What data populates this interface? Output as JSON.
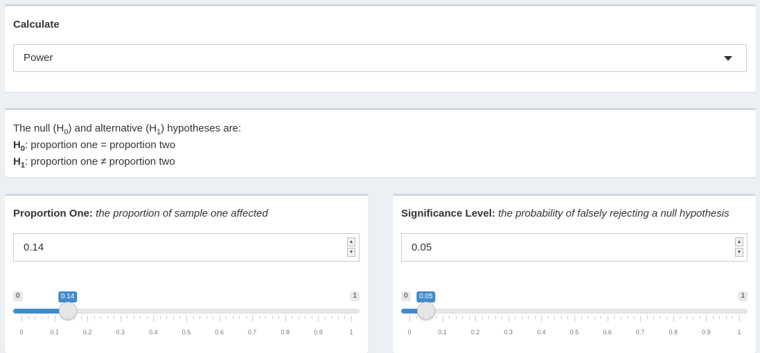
{
  "calculate": {
    "label": "Calculate",
    "selected": "Power"
  },
  "hypotheses": {
    "intro_a": "The null (H",
    "intro_sub0": "0",
    "intro_b": ") and alternative (H",
    "intro_sub1": "1",
    "intro_c": ") hypotheses are:",
    "h0_letter": "H",
    "h0_sub": "0",
    "h0_text": ": proportion one = proportion two",
    "h1_letter": "H",
    "h1_sub": "1",
    "h1_text": ": proportion one ≠ proportion two"
  },
  "proportion_one": {
    "label_bold": "Proportion One:",
    "label_italic": "the proportion of sample one affected",
    "value": "0.14",
    "min_label": "0",
    "max_label": "1",
    "slider_value": 0.14,
    "slider_value_label": "0.14",
    "tick_labels": [
      "0",
      "0.1",
      "0.2",
      "0.3",
      "0.4",
      "0.5",
      "0.6",
      "0.7",
      "0.8",
      "0.9",
      "1"
    ]
  },
  "significance": {
    "label_bold": "Significance Level:",
    "label_italic": "the probability of falsely rejecting a null hypothesis",
    "value": "0.05",
    "min_label": "0",
    "max_label": "1",
    "slider_value": 0.05,
    "slider_value_label": "0.05",
    "tick_labels": [
      "0",
      "0.1",
      "0.2",
      "0.3",
      "0.4",
      "0.5",
      "0.6",
      "0.7",
      "0.8",
      "0.9",
      "1"
    ]
  },
  "spinner": {
    "up": "▲",
    "down": "▼"
  }
}
